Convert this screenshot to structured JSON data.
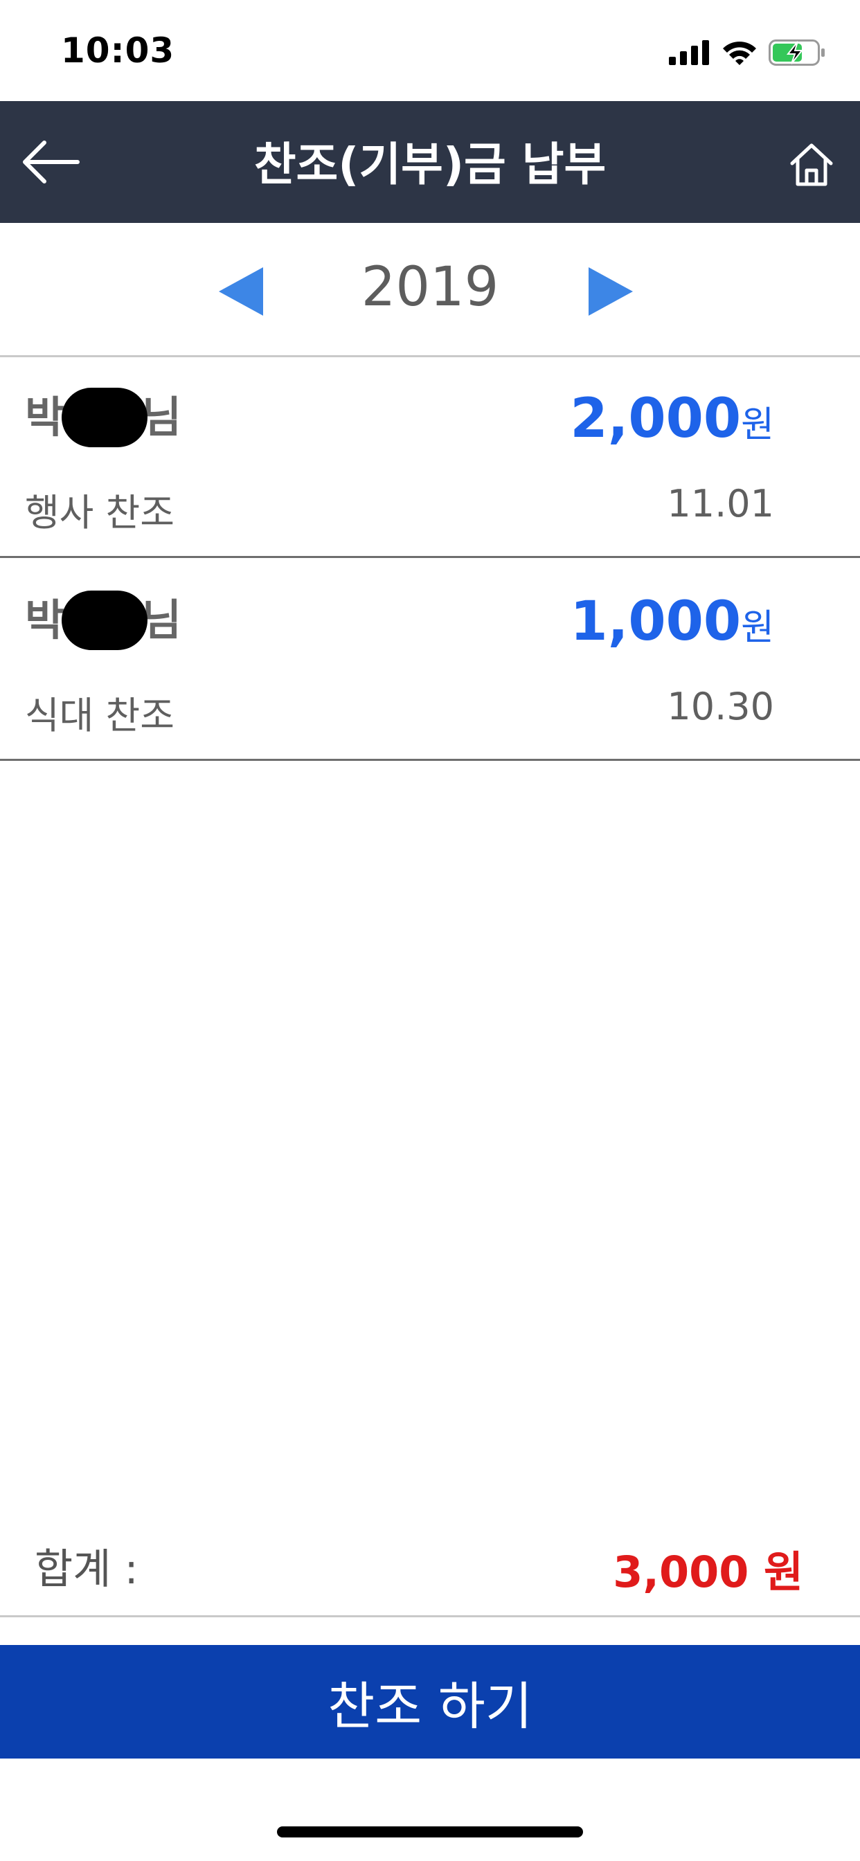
{
  "status_bar": {
    "time": "10:03",
    "icons": [
      "signal-icon",
      "wifi-icon",
      "battery-charging-icon"
    ]
  },
  "nav": {
    "title": "찬조(기부)금 납부",
    "back_icon": "arrow-left-icon",
    "home_icon": "home-icon"
  },
  "year_selector": {
    "year": "2019",
    "prev_icon": "triangle-left-icon",
    "next_icon": "triangle-right-icon"
  },
  "records": [
    {
      "name_first": "박",
      "name_suffix": "님",
      "amount": "2,000",
      "unit": "원",
      "type": "행사 찬조",
      "date": "11.01"
    },
    {
      "name_first": "박",
      "name_suffix": "님",
      "amount": "1,000",
      "unit": "원",
      "type": "식대 찬조",
      "date": "10.30"
    }
  ],
  "total": {
    "label": "합계 :",
    "value": "3,000 원"
  },
  "donate_button": {
    "label": "찬조 하기"
  },
  "colors": {
    "nav_background": "#2d3546",
    "amount": "#1e63e9",
    "total": "#e01b1b",
    "button": "#0b40ae",
    "arrows": "#3d86e6"
  }
}
